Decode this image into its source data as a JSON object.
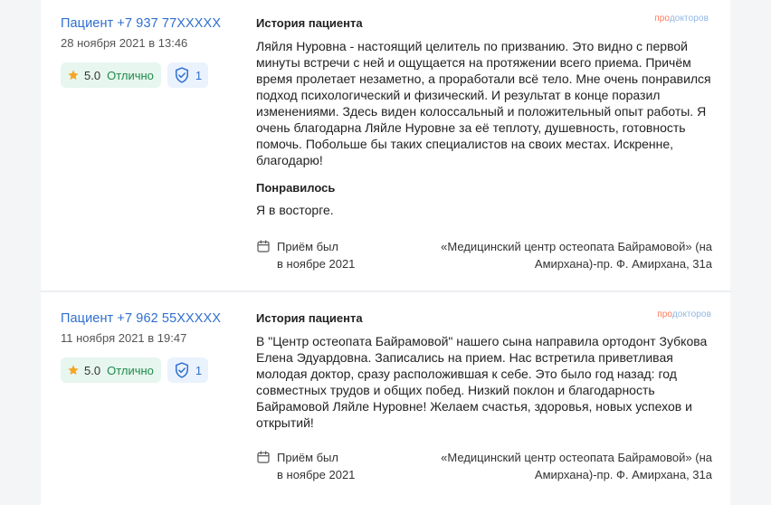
{
  "reviews": [
    {
      "patient": "Пациент +7 937 77XXXXX",
      "date": "28 ноября 2021 в 13:46",
      "score": "5.0",
      "score_word": "Отлично",
      "verified_count": "1",
      "history_title": "История пациента",
      "history_text": "Ляйля Нуровна - настоящий целитель по призванию. Это видно с первой минуты встречи с ней и ощущается на протяжении всего приема. Причём время пролетает незаметно, а проработали всё тело. Мне очень понравился подход психологический и физический. И результат в конце поразил изменениями. Здесь виден колоссальный и положительный опыт работы. Я очень благодарна Ляйле Нуровне за её теплоту, душевность, готовность помочь. Побольше бы таких специалистов на своих местах. Искренне, благодарю!",
      "liked_title": "Понравилось",
      "liked_text": "Я в восторге.",
      "visit_line1": "Приём был",
      "visit_line2": "в ноябре 2021",
      "clinic_line1": "«Медицинский центр остеопата Байрамовой» (на",
      "clinic_line2": "Амирхана)-пр. Ф. Амирхана, 31а"
    },
    {
      "patient": "Пациент +7 962 55XXXXX",
      "date": "11 ноября 2021 в 19:47",
      "score": "5.0",
      "score_word": "Отлично",
      "verified_count": "1",
      "history_title": "История пациента",
      "history_text": "В \"Центр остеопата Байрамовой\" нашего сына направила ортодонт Зубкова Елена Эдуардовна. Записались на прием. Нас встретила приветливая молодая доктор, сразу расположившая к себе. Это было год назад: год совместных трудов и общих побед. Низкий поклон и благодарность Байрамовой Ляйле Нуровне! Желаем счастья, здоровья, новых успехов и открытий!",
      "visit_line1": "Приём был",
      "visit_line2": "в ноябре 2021",
      "clinic_line1": "«Медицинский центр остеопата Байрамовой» (на",
      "clinic_line2": "Амирхана)-пр. Ф. Амирхана, 31а"
    }
  ],
  "logo": {
    "pro": "про",
    "doc": "докторов"
  },
  "colors": {
    "link": "#2f6fcf",
    "rating_bg": "#e7f6ee",
    "rating_text": "#1f8a4c",
    "verified_bg": "#eaf2fd",
    "star": "#f5a623",
    "logo_pro": "#ff7a59",
    "logo_doc": "#8fb7e3"
  },
  "icons": {
    "star": "star-icon",
    "verified": "shield-check-icon",
    "calendar": "calendar-icon"
  }
}
